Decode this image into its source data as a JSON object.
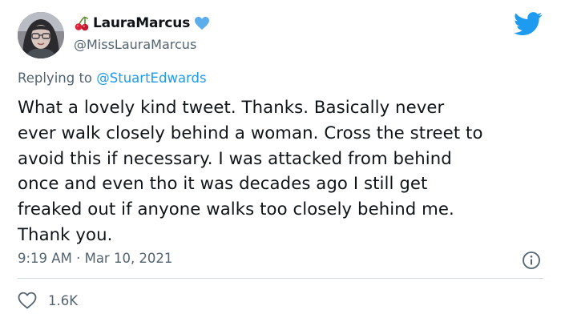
{
  "author": {
    "display_name": "LauraMarcus",
    "handle": "@MissLauraMarcus",
    "name_emoji_before": "cherries-icon",
    "name_emoji_after": "blue-heart-icon"
  },
  "reply": {
    "prefix": "Replying to ",
    "target": "@StuartEdwards"
  },
  "tweet": {
    "text": "What a lovely kind tweet. Thanks. Basically never\never walk closely behind a woman. Cross the street to\navoid this if necessary. I was attacked from behind\nonce and even tho it was decades ago I still get\nfreaked out if anyone walks too closely behind me.\nThank you.",
    "time": "9:19 AM",
    "separator": " · ",
    "date": "Mar 10, 2021"
  },
  "stats": {
    "likes": "1.6K"
  },
  "colors": {
    "brand_blue": "#1d9bf0",
    "secondary_text": "#536471",
    "primary_text": "#0f1419",
    "divider": "#cfd9de"
  },
  "icons": {
    "logo": "twitter-bird-icon",
    "info": "info-icon",
    "like": "heart-outline-icon"
  }
}
